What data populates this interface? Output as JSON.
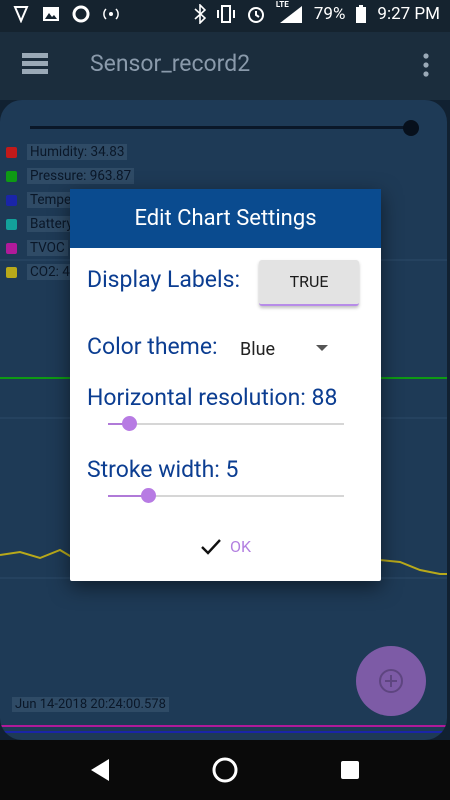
{
  "status_bar": {
    "battery_percent": "79%",
    "time": "9:27 PM",
    "network": "LTE",
    "icons": [
      "app-icon",
      "image-icon",
      "circle-icon",
      "hotspot-icon",
      "bluetooth-icon",
      "vibrate-icon",
      "alarm-icon",
      "signal-icon",
      "battery-icon"
    ]
  },
  "app_bar": {
    "title": "Sensor_record2"
  },
  "legend": [
    {
      "label": "Humidity: 34.83",
      "color": "#c21a1a"
    },
    {
      "label": "Pressure: 963.87",
      "color": "#0e9a14"
    },
    {
      "label": "Tempe",
      "color": "#1a25a8"
    },
    {
      "label": "Battery",
      "color": "#13a19a"
    },
    {
      "label": "TVOC",
      "color": "#b01a9a"
    },
    {
      "label": "CO2: 4",
      "color": "#b8a91a"
    }
  ],
  "chart": {
    "date_label": "Jun 14-2018 20:24:00.578"
  },
  "dialog": {
    "title": "Edit Chart Settings",
    "display_labels_label": "Display Labels:",
    "display_labels_value": "TRUE",
    "color_theme_label": "Color theme:",
    "color_theme_value": "Blue",
    "horizontal_resolution_label": "Horizontal resolution: 88",
    "horizontal_resolution_level": 0.09,
    "stroke_width_label": "Stroke width: 5",
    "stroke_width_level": 0.17,
    "ok_label": "OK"
  },
  "colors": {
    "dialog_header": "#0a4b8f",
    "accent": "#b77be3",
    "label_text": "#0b3d91"
  }
}
